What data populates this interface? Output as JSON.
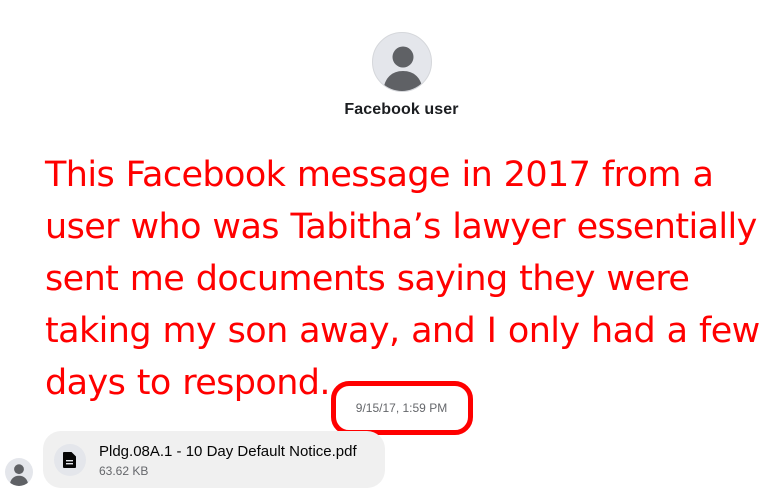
{
  "profile": {
    "name": "Facebook user",
    "avatar_icon": "default-user-avatar-icon"
  },
  "annotation": {
    "text": "This Facebook message in 2017 from a user who was Tabitha’s lawyer essentially sent me documents saying they were taking my son away, and I only had a few days to respond.",
    "color": "#ff0000"
  },
  "conversation": {
    "timestamp": "9/15/17, 1:59 PM",
    "highlight_color": "#ff0000",
    "message": {
      "sender_avatar_icon": "default-user-avatar-icon",
      "attachment": {
        "icon": "document-icon",
        "file_name": "Pldg.08A.1 - 10 Day Default Notice.pdf",
        "file_size": "63.62 KB"
      }
    }
  },
  "colors": {
    "bubble_background": "#f0f0f0",
    "avatar_background": "#e4e6eb",
    "avatar_silhouette": "#5f6165",
    "secondary_text": "#65676b"
  }
}
